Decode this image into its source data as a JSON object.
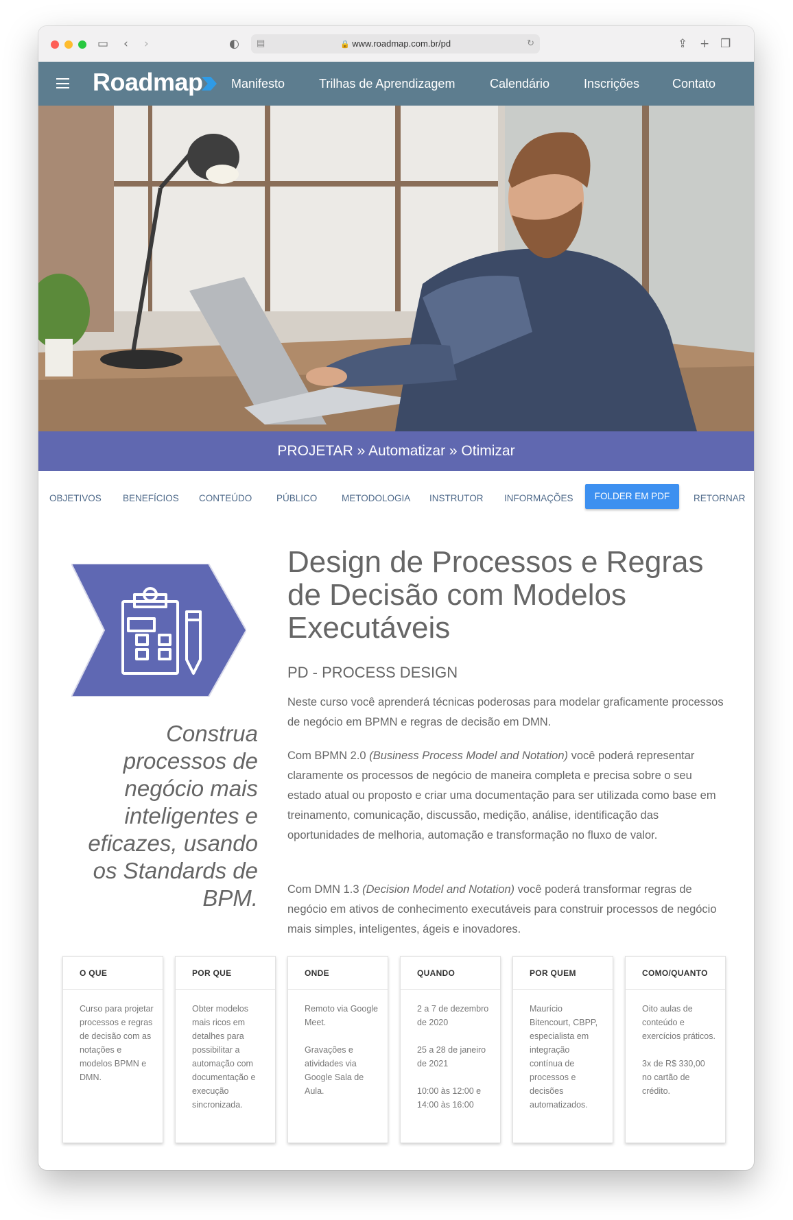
{
  "browser": {
    "url": "www.roadmap.com.br/pd"
  },
  "nav": {
    "logo": "Roadmap",
    "links": [
      "Manifesto",
      "Trilhas de Aprendizagem",
      "Calendário",
      "Inscrições",
      "Contato"
    ]
  },
  "band": {
    "text": "PROJETAR » Automatizar » Otimizar"
  },
  "tabs": {
    "items": [
      "OBJETIVOS",
      "BENEFÍCIOS",
      "CONTEÚDO",
      "PÚBLICO",
      "METODOLOGIA",
      "INSTRUTOR",
      "INFORMAÇÕES"
    ],
    "active": "FOLDER EM PDF",
    "last": "RETORNAR"
  },
  "content": {
    "tagline": "Construa processos de negócio mais inteligentes e eficazes, usando os Standards de BPM.",
    "title": "Design de Processos e Regras de Decisão com Modelos Executáveis",
    "subtitle": "PD - PROCESS DESIGN",
    "p1": "Neste curso você aprenderá técnicas poderosas para modelar graficamente processos de negócio em BPMN e regras de decisão em DMN.",
    "p2_prefix": "Com BPMN 2.0 ",
    "p2_italic": "(Business Process Model and Notation)",
    "p2_rest": " você poderá representar claramente os processos de negócio de maneira completa e precisa sobre o seu estado atual ou proposto e criar uma documentação para ser utilizada como base em treinamento, comunicação, discussão, medição, análise, identificação das oportunidades de melhoria, automação e transformação no fluxo de valor.",
    "p3_prefix": "Com DMN 1.3 ",
    "p3_italic": "(Decision Model and Notation)",
    "p3_rest": " você poderá transformar regras de negócio em ativos de conhecimento executáveis para construir processos de negócio mais simples, inteligentes, ágeis e inovadores."
  },
  "cards": [
    {
      "heading": "O QUE",
      "lines": [
        "Curso para projetar processos e regras de decisão com as notações e modelos BPMN e DMN."
      ]
    },
    {
      "heading": "POR QUE",
      "lines": [
        "Obter modelos mais ricos em detalhes para possibilitar a automação com documentação e execução sincronizada."
      ]
    },
    {
      "heading": "ONDE",
      "lines": [
        "Remoto via Google Meet.",
        "Gravações e atividades via Google Sala de Aula."
      ]
    },
    {
      "heading": "QUANDO",
      "lines": [
        "2 a 7 de dezembro de 2020",
        "25 a 28 de janeiro de 2021",
        "10:00 às 12:00 e 14:00 às 16:00"
      ]
    },
    {
      "heading": "POR QUEM",
      "lines": [
        "Maurício Bitencourt, CBPP, especialista em integração contínua de processos e decisões automatizados."
      ]
    },
    {
      "heading": "COMO/QUANTO",
      "lines": [
        "Oito aulas de conteúdo e exercícios práticos.",
        "3x de R$ 330,00 no cartão de crédito."
      ]
    }
  ],
  "colors": {
    "nav": "#5d7d8f",
    "band": "#6068b0",
    "accent_button": "#3d90f0",
    "logo_mark": "#2f9be6"
  }
}
